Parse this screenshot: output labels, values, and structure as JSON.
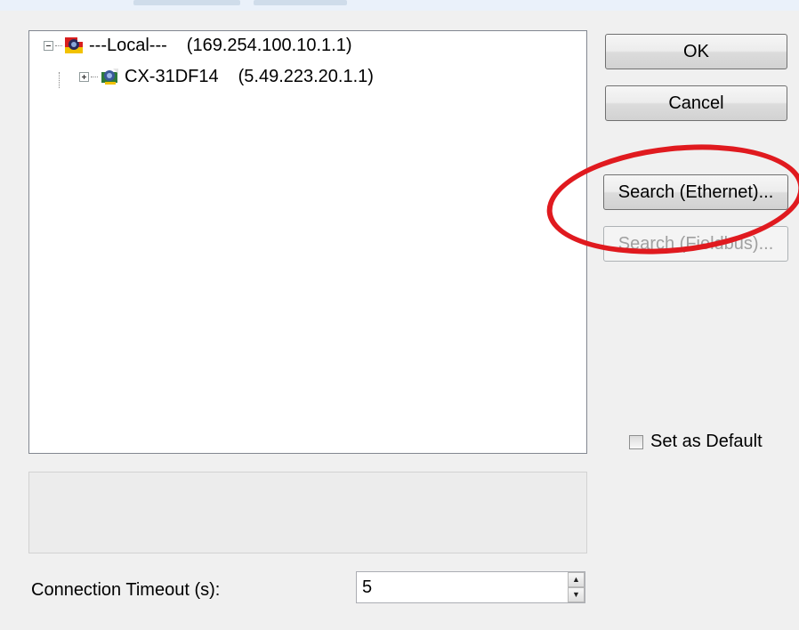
{
  "tree": {
    "items": [
      {
        "name": "---Local---",
        "address": "(169.254.100.10.1.1)",
        "expanded": true
      },
      {
        "name": "CX-31DF14",
        "address": "(5.49.223.20.1.1)",
        "expanded": false
      }
    ]
  },
  "buttons": {
    "ok_label": "OK",
    "cancel_label": "Cancel",
    "search_ethernet_label": "Search (Ethernet)...",
    "search_fieldbus_label": "Search (Fieldbus)..."
  },
  "set_as_default": {
    "label": "Set as Default",
    "checked": false
  },
  "timeout": {
    "label": "Connection Timeout (s):",
    "value": "5"
  },
  "colors": {
    "annotation": "#e01a1f",
    "tree_background": "#ffffff",
    "dialog_background": "#f0f0f0"
  }
}
